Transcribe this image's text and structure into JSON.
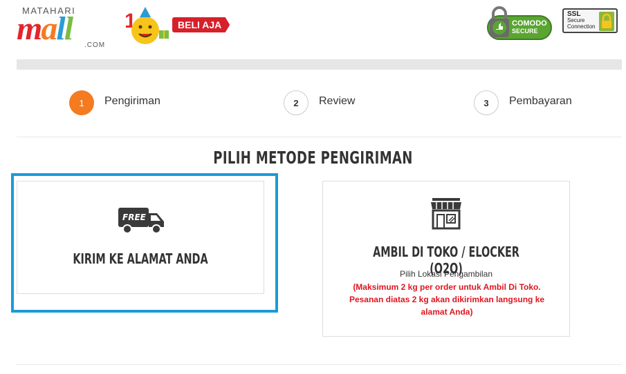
{
  "header": {
    "logo_small": "MATAHARI",
    "logo_main": [
      "m",
      "a",
      "l",
      "l"
    ],
    "logo_com": ".COM",
    "promo_label": "BELI AJA",
    "comodo": {
      "line1": "COMODO",
      "line2": "SECURE"
    },
    "ssl": {
      "line1": "SSL",
      "line2": "Secure",
      "line3": "Connection"
    }
  },
  "steps": [
    {
      "number": "1",
      "label": "Pengiriman",
      "active": true
    },
    {
      "number": "2",
      "label": "Review",
      "active": false
    },
    {
      "number": "3",
      "label": "Pembayaran",
      "active": false
    }
  ],
  "section_title": "PILIH METODE PENGIRIMAN",
  "options": {
    "delivery": {
      "icon": "free-delivery-truck-icon",
      "icon_text": "FREE",
      "title": "KIRIM KE ALAMAT ANDA",
      "selected": true
    },
    "pickup": {
      "icon": "store-icon",
      "title": "AMBIL DI TOKO / ELOCKER (O2O)",
      "subtitle": "Pilih Lokasi Pengambilan",
      "note": "(Maksimum 2 kg per order untuk Ambil Di Toko. Pesanan diatas 2 kg akan dikirimkan langsung ke alamat Anda)"
    }
  },
  "colors": {
    "accent_orange": "#f47b20",
    "selection_blue": "#1a9bd7",
    "warning_red": "#e0141e"
  }
}
